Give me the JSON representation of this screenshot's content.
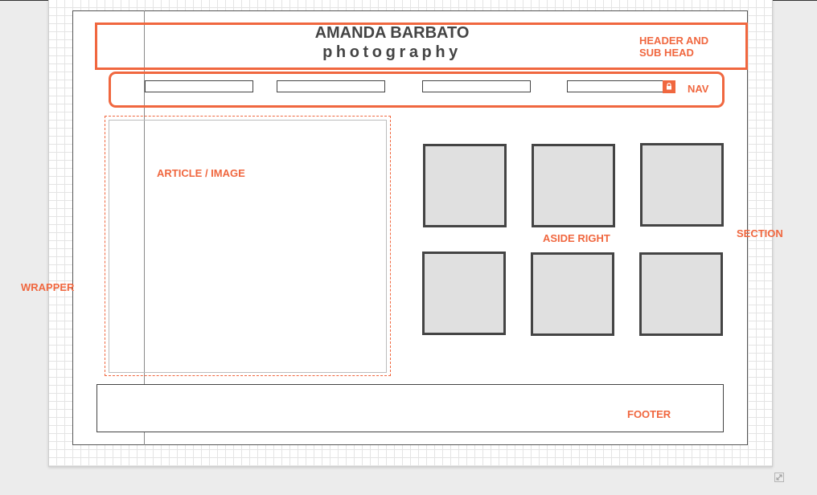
{
  "site": {
    "title": "AMANDA BARBATO",
    "subtitle": "photography"
  },
  "labels": {
    "header": [
      "HEADER AND",
      "SUB HEAD"
    ],
    "nav": "NAV",
    "article": "ARTICLE / IMAGE",
    "aside": "ASIDE RIGHT",
    "section": "SECTION",
    "wrapper": "WRAPPER",
    "footer": "FOOTER"
  },
  "nav_items": [
    "",
    "",
    "",
    ""
  ],
  "thumbnails_count": 6,
  "colors": {
    "accent": "#f0673f",
    "outline": "#444444",
    "thumb_fill": "#e0e0e0",
    "grid": "#e4e4e4"
  },
  "icons": {
    "nav_lock": "lock-icon",
    "resize": "resize-icon"
  }
}
